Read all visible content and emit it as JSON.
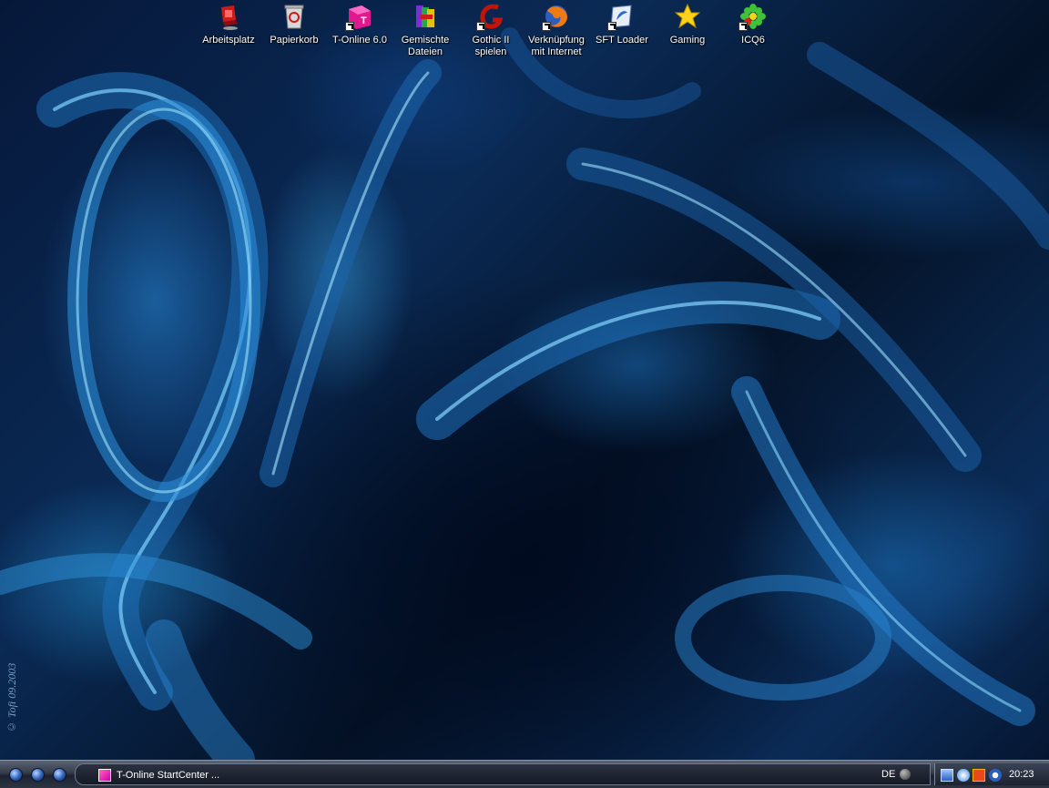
{
  "desktop": {
    "watermark": "© Tofi 09.2003",
    "icons": [
      {
        "label": "Arbeitsplatz",
        "icon": "computer-icon"
      },
      {
        "label": "Papierkorb",
        "icon": "recycle-bin-icon"
      },
      {
        "label": "T-Online 6.0",
        "icon": "t-online-icon"
      },
      {
        "label": "Gemischte Dateien",
        "icon": "folder-archive-icon"
      },
      {
        "label": "Gothic II spielen",
        "icon": "gothic-game-icon"
      },
      {
        "label": "Verknüpfung mit Internet",
        "icon": "firefox-icon"
      },
      {
        "label": "SFT Loader",
        "icon": "sft-loader-icon"
      },
      {
        "label": "Gaming",
        "icon": "star-icon"
      },
      {
        "label": "ICQ6",
        "icon": "icq-flower-icon"
      }
    ]
  },
  "taskbar": {
    "active_task": "T-Online StartCenter ...",
    "language": "DE",
    "clock": "20:23",
    "colors": {
      "accent": "#2c5fb8",
      "bar": "#343b49"
    }
  }
}
